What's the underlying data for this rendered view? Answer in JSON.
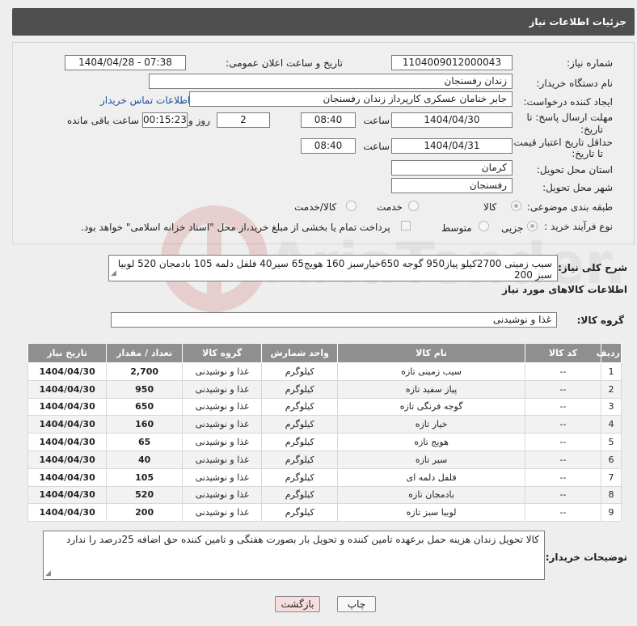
{
  "header": {
    "title": "جزئیات اطلاعات نیاز"
  },
  "form": {
    "need_number_label": "شماره نیاز:",
    "need_number": "1104009012000043",
    "announce_label": "تاریخ و ساعت اعلان عمومی:",
    "announce_value": "1404/04/28 - 07:38",
    "buyer_org_label": "نام دستگاه خریدار:",
    "buyer_org": "زندان رفسنجان",
    "requester_label": "ایجاد کننده درخواست:",
    "requester": "جابر خنامان عسکری کارپرداز زندان رفسنجان",
    "contact_link": "اطلاعات تماس خریدار",
    "deadline_label_1": "مهلت ارسال پاسخ: تا",
    "deadline_label_2": "تاریخ:",
    "deadline_date": "1404/04/30",
    "time_label": "ساعت",
    "deadline_time": "08:40",
    "days_value": "2",
    "days_label": "روز و",
    "remaining_time": "00:15:23",
    "remaining_label": "ساعت باقی مانده",
    "price_validity_label_1": "حداقل تاریخ اعتبار قیمت:",
    "price_validity_label_2": "تا تاریخ:",
    "price_validity_date": "1404/04/31",
    "price_validity_time": "08:40",
    "province_label": "استان محل تحویل:",
    "province": "کرمان",
    "city_label": "شهر محل تحویل:",
    "city": "رفسنجان",
    "category_label": "طبقه بندی موضوعی:",
    "category_options": [
      "کالا",
      "خدمت",
      "کالا/خدمت"
    ],
    "category_selected": "کالا",
    "process_label": "نوع فرآیند خرید :",
    "process_options": [
      "جزیی",
      "متوسط"
    ],
    "process_selected": "جزیی",
    "payment_note": "پرداخت تمام یا بخشی از مبلغ خرید،از محل \"اسناد خزانه اسلامی\" خواهد بود."
  },
  "description": {
    "label": "شرح کلی نیاز:",
    "text": "سیب زمینی 2700کیلو پیاز950 گوجه 650خیارسبز 160 هویج65 سیر40 فلفل دلمه 105 بادمجان 520 لوبیا سبز 200"
  },
  "goods": {
    "section_title": "اطلاعات کالاهای مورد نیاز",
    "group_label": "گروه کالا:",
    "group_value": "غذا و نوشیدنی",
    "columns": [
      "ردیف",
      "کد کالا",
      "نام کالا",
      "واحد شمارش",
      "گروه کالا",
      "تعداد / مقدار",
      "تاریخ نیاز"
    ],
    "rows": [
      [
        "1",
        "--",
        "سیب زمینی تازه",
        "کیلوگرم",
        "غذا و نوشیدنی",
        "2,700",
        "1404/04/30"
      ],
      [
        "2",
        "--",
        "پیاز سفید تازه",
        "کیلوگرم",
        "غذا و نوشیدنی",
        "950",
        "1404/04/30"
      ],
      [
        "3",
        "--",
        "گوجه فرنگی تازه",
        "کیلوگرم",
        "غذا و نوشیدنی",
        "650",
        "1404/04/30"
      ],
      [
        "4",
        "--",
        "خیار تازه",
        "کیلوگرم",
        "غذا و نوشیدنی",
        "160",
        "1404/04/30"
      ],
      [
        "5",
        "--",
        "هویج تازه",
        "کیلوگرم",
        "غذا و نوشیدنی",
        "65",
        "1404/04/30"
      ],
      [
        "6",
        "--",
        "سیر تازه",
        "کیلوگرم",
        "غذا و نوشیدنی",
        "40",
        "1404/04/30"
      ],
      [
        "7",
        "--",
        "فلفل دلمه ای",
        "کیلوگرم",
        "غذا و نوشیدنی",
        "105",
        "1404/04/30"
      ],
      [
        "8",
        "--",
        "بادمجان تازه",
        "کیلوگرم",
        "غذا و نوشیدنی",
        "520",
        "1404/04/30"
      ],
      [
        "9",
        "--",
        "لوبیا سبز تازه",
        "کیلوگرم",
        "غذا و نوشیدنی",
        "200",
        "1404/04/30"
      ]
    ]
  },
  "buyer_notes": {
    "label": "توضیحات خریدار:",
    "text": "کالا تحویل زندان هزینه حمل برعهده تامین کننده و تحویل بار بصورت هفتگی و تامین کننده حق اضافه 25درصد را ندارد"
  },
  "buttons": {
    "print": "چاپ",
    "back": "بازگشت"
  },
  "watermark_text": "AriaTender.neT",
  "colors": {
    "header_bg": "#4f4f4f",
    "table_header_bg": "#8f8f8f",
    "back_button_bg": "#f6dede",
    "link": "#1a4f9c"
  }
}
